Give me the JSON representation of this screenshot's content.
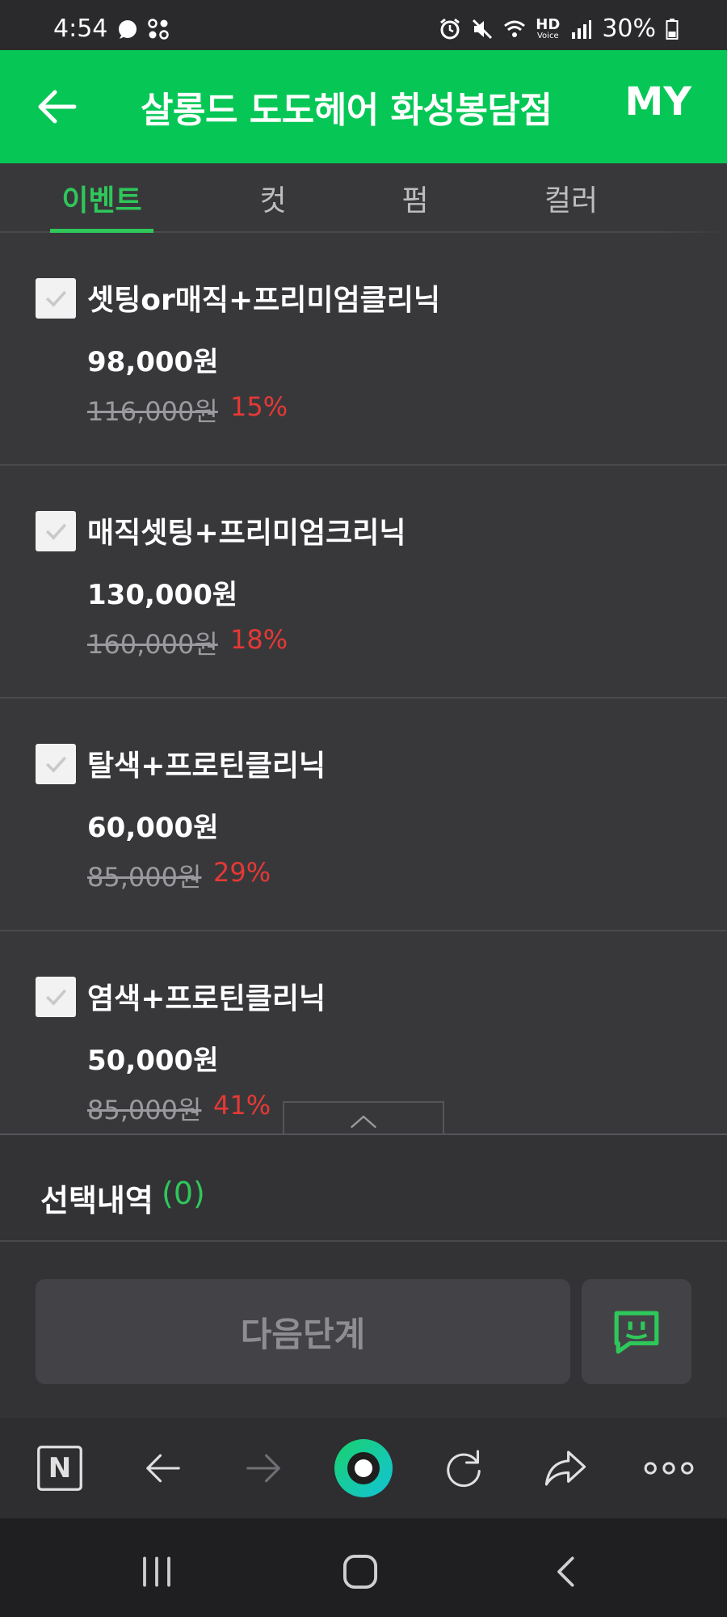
{
  "status_bar": {
    "time": "4:54",
    "network": "HD",
    "network_sub": "Voice",
    "battery": "30%"
  },
  "header": {
    "title": "살롱드 도도헤어 화성봉담점",
    "my_label": "MY",
    "back_icon": "arrow-left-icon"
  },
  "tabs": [
    {
      "label": "이벤트",
      "active": true
    },
    {
      "label": "컷",
      "active": false
    },
    {
      "label": "펌",
      "active": false
    },
    {
      "label": "컬러",
      "active": false
    }
  ],
  "items": [
    {
      "title": "셋팅or매직+프리미엄클리닉",
      "price": "98,000원",
      "original": "116,000원",
      "discount": "15%"
    },
    {
      "title": "매직셋팅+프리미엄크리닉",
      "price": "130,000원",
      "original": "160,000원",
      "discount": "18%"
    },
    {
      "title": "탈색+프로틴클리닉",
      "price": "60,000원",
      "original": "85,000원",
      "discount": "29%"
    },
    {
      "title": "염색+프로틴클리닉",
      "price": "50,000원",
      "original": "85,000원",
      "discount": "41%"
    }
  ],
  "selection": {
    "label": "선택내역",
    "count": "(0)"
  },
  "actions": {
    "next_label": "다음단계",
    "chat_icon": "chat-bubble-icon"
  },
  "browser_bar": {
    "home_letter": "N"
  },
  "colors": {
    "brand_green": "#06c755",
    "accent_green": "#2fc75a",
    "discount_red": "#e53935",
    "background": "#38383b"
  }
}
